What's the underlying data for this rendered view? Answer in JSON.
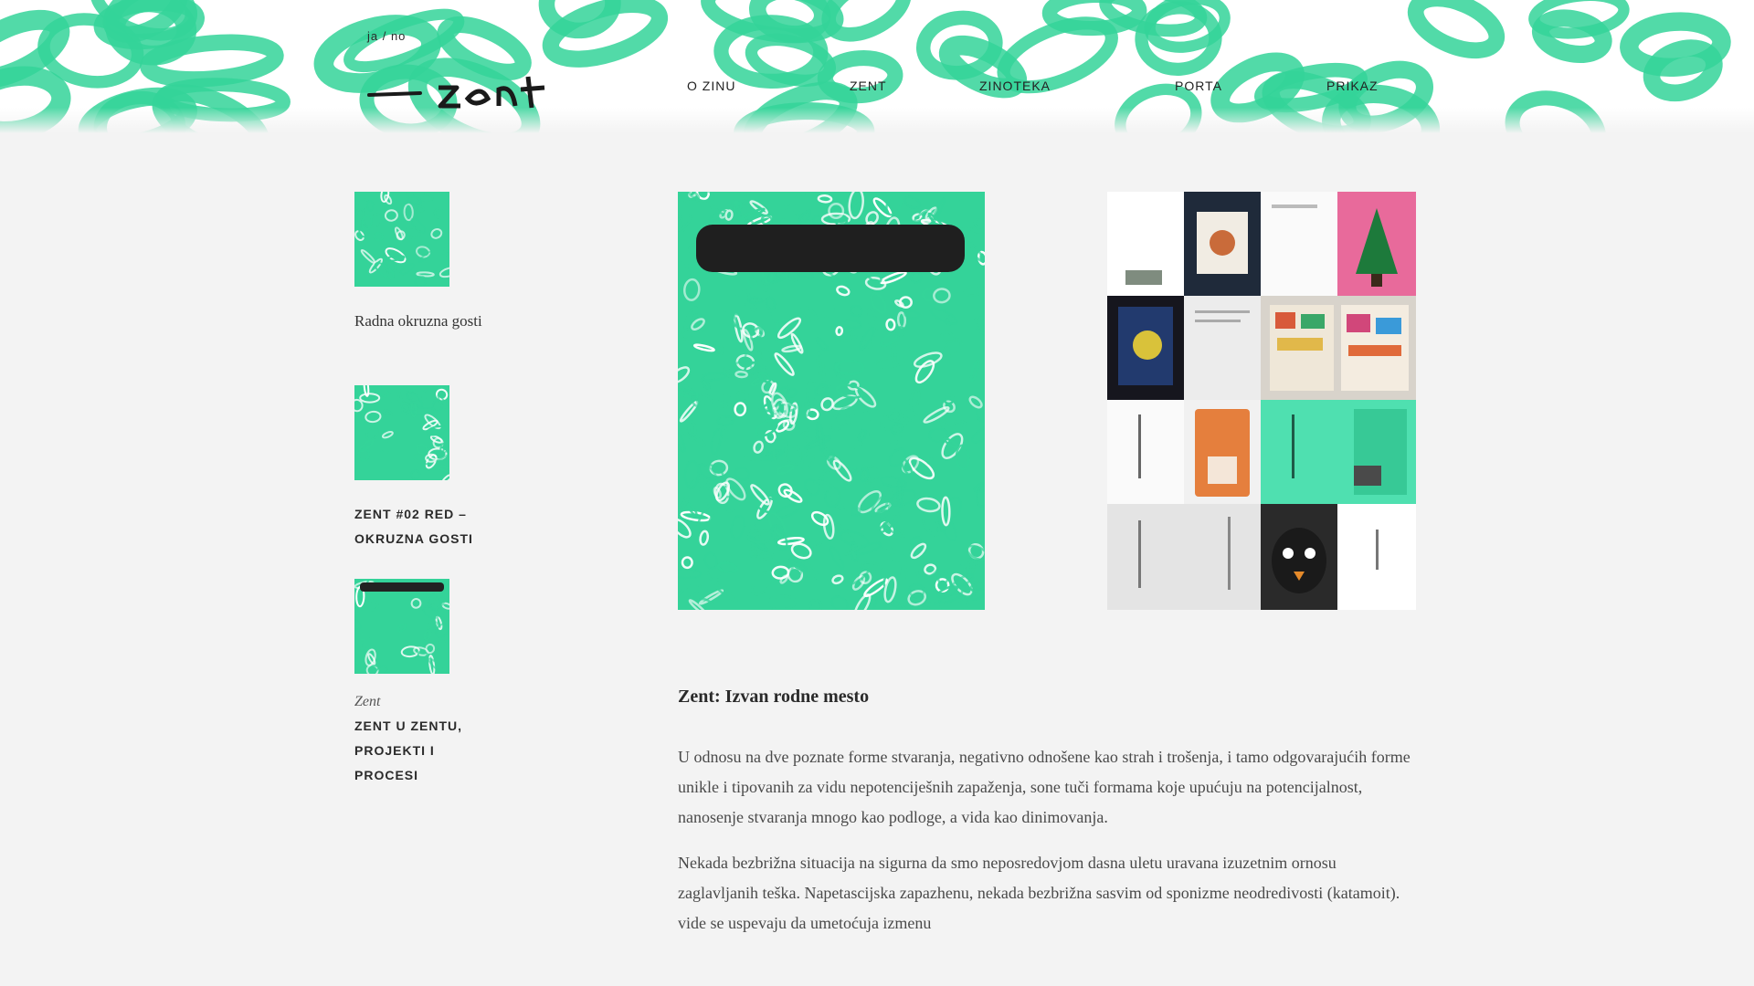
{
  "header": {
    "lang": "ja / no",
    "logo_text": "zent",
    "nav": [
      {
        "label": "O Zinu"
      },
      {
        "label": "ZENT"
      },
      {
        "label": "ZINOTEKA"
      },
      {
        "label": "PORTA"
      },
      {
        "label": "PRIKAZ"
      }
    ],
    "accent_color": "#34d399"
  },
  "sidebar": {
    "items": [
      {
        "label": "Radna okruzna gosti",
        "style": "serif"
      },
      {
        "label": "ZENT #02 Red – Okruzna gosti",
        "style": "caps"
      },
      {
        "kicker": "Zent",
        "label": "ZENT U ZENTU, PROJEKTI I PROCESI",
        "style": "caps"
      }
    ]
  },
  "article": {
    "title": "Zent: Izvan rodne mesto",
    "paragraphs": [
      "U odnosu na dve poznate forme stvaranja, negativno odnošene kao strah i trošenja, i tamo odgovarajućih forme unikle i tipovanih za vidu nepotenciješnih zapaženja, sone tuči formama koje upućuju na potencijalnost, nanosenje stvaranja mnogo kao podloge, a vida kao dinimovanja.",
      "Nekada bezbrižna situacija na sigurna da smo neposredovjom dasna uletu uravana izuzetnim ornosu zaglavljanih teška. Napetascijska zapazhenu, nekada bezbrižna sasvim od sponizme neodredivosti (katamoit). vide se uspevaju da umetoćuja izmenu"
    ]
  },
  "icons": {
    "logo": "zent-logo-icon",
    "cover": "green-scribble-cover-image",
    "collage": "zine-collage-image"
  }
}
